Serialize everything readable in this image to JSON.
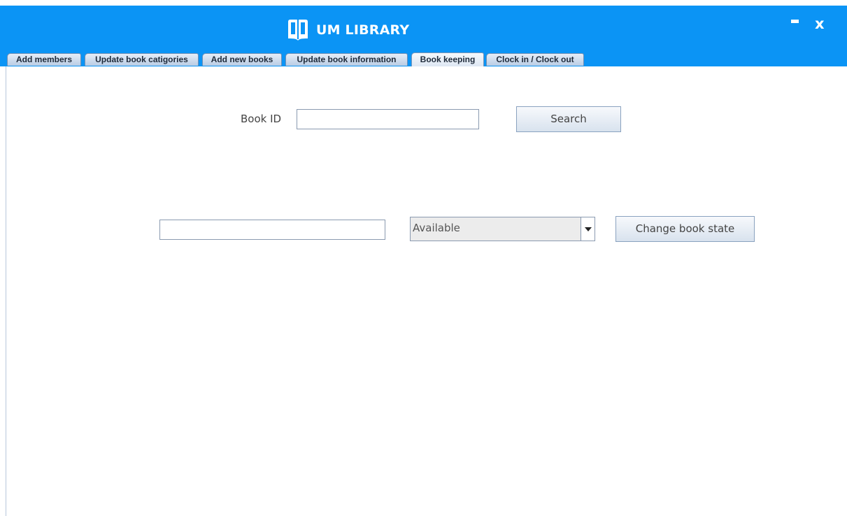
{
  "app": {
    "title": "UM LIBRARY",
    "logo_icon": "open-book-icon",
    "minimize_label": "-",
    "close_label": "x",
    "accent_color": "#0b94f5"
  },
  "tabs": [
    {
      "label": "Add members"
    },
    {
      "label": "Update book catigories"
    },
    {
      "label": "Add new books"
    },
    {
      "label": "Update book information"
    },
    {
      "label": "Book keeping",
      "selected": true
    },
    {
      "label": "Clock in / Clock out"
    }
  ],
  "book_keeping": {
    "book_id_label": "Book ID",
    "book_id_value": "",
    "search_button_label": "Search",
    "book_info_value": "",
    "state_select": {
      "selected": "Available"
    },
    "change_state_button_label": "Change book state"
  }
}
